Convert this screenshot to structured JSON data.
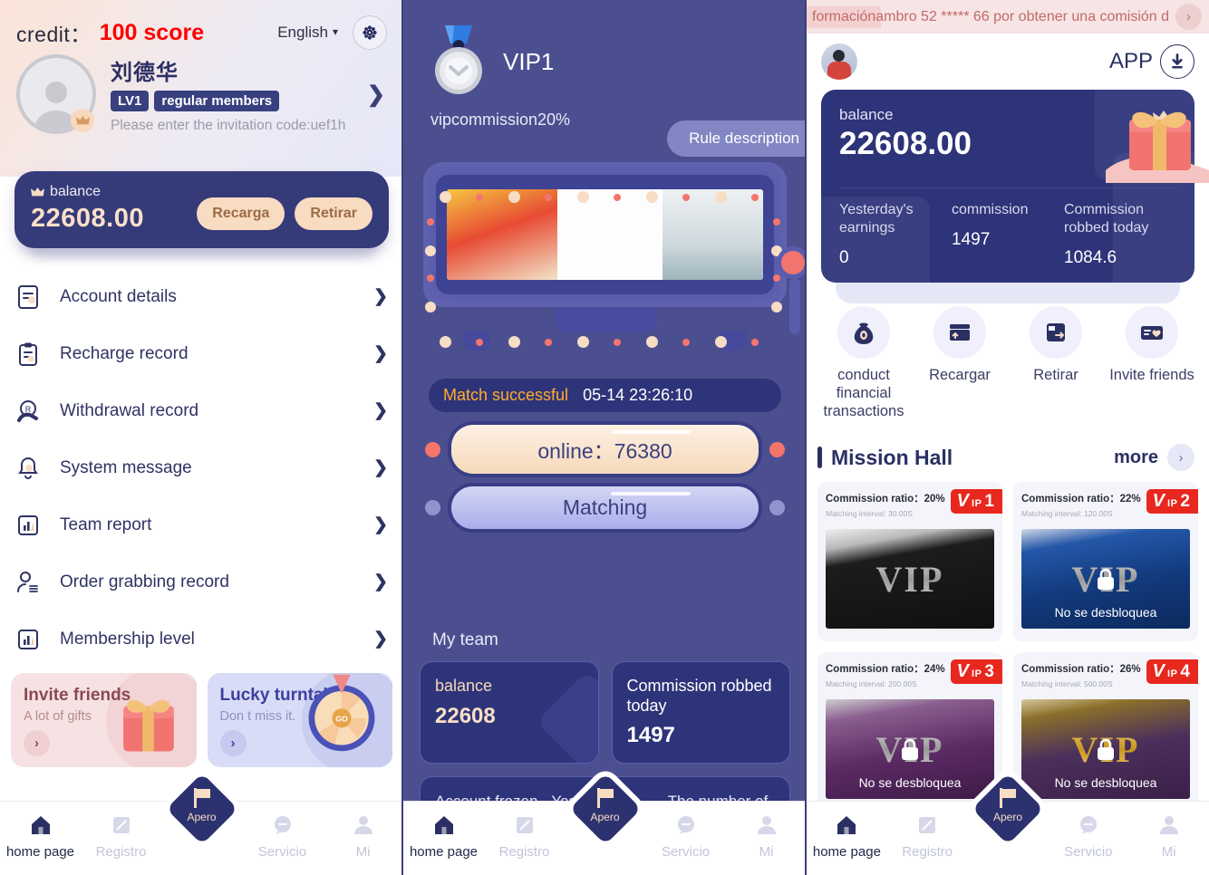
{
  "screen1": {
    "credit": {
      "label": "credit：",
      "value": "100 score"
    },
    "language": {
      "value": "English",
      "chevron": "⌄"
    },
    "settings_icon": "gear-icon",
    "profile": {
      "username": "刘德华",
      "level_tag": "LV1",
      "member_tag": "regular members",
      "invite_note": "Please enter the invitation code:uef1h",
      "chevron": "❯"
    },
    "balance_card": {
      "label": "balance",
      "amount": "22608.00",
      "recharge_label": "Recarga",
      "withdraw_label": "Retirar"
    },
    "menu": [
      {
        "label": "Account details",
        "icon": "document-list-icon",
        "chevron": "❯"
      },
      {
        "label": "Recharge record",
        "icon": "clipboard-icon",
        "chevron": "❯"
      },
      {
        "label": "Withdrawal record",
        "icon": "withdraw-hand-icon",
        "chevron": "❯"
      },
      {
        "label": "System message",
        "icon": "bell-icon",
        "chevron": "❯"
      },
      {
        "label": "Team report",
        "icon": "bar-chart-icon",
        "chevron": "❯"
      },
      {
        "label": "Order grabbing record",
        "icon": "person-list-icon",
        "chevron": "❯"
      },
      {
        "label": "Membership level",
        "icon": "bar-chart-icon",
        "chevron": "❯"
      }
    ],
    "promos": [
      {
        "title": "Invite friends",
        "subtitle": "A lot of gifts",
        "arrow": "›",
        "icon": "gift-box-icon"
      },
      {
        "title": "Lucky turntable",
        "subtitle": "Don t miss it.",
        "arrow": "›",
        "icon": "fortune-wheel-icon",
        "wheel_text": "GO"
      }
    ]
  },
  "screen2": {
    "vip": {
      "level": "VIP1",
      "commission": "vipcommission20%",
      "medal_icon": "medal-icon"
    },
    "rule_button": "Rule description",
    "match": {
      "status": "Match successful",
      "time": "05-14 23:26:10"
    },
    "online": {
      "label": "online：",
      "value": "76380"
    },
    "matching_label": "Matching",
    "my_team": {
      "title": "My team",
      "cards": [
        {
          "label": "balance",
          "value": "22608"
        },
        {
          "label": "Commission robbed today",
          "value": "1497"
        }
      ],
      "row2": [
        "Account frozen",
        "Yesterday's earnings",
        "The number of"
      ]
    }
  },
  "screen3": {
    "notice": {
      "tag": "formación",
      "text": "ambro 52 ***** 66 por obtener una comisión d",
      "next_arrow": "›"
    },
    "header": {
      "app_label": "APP",
      "download_icon": "download-arrow-icon",
      "avatar": "user-avatar"
    },
    "balance_card": {
      "label": "balance",
      "amount": "22608.00",
      "crown_icon": "crown-icon",
      "stats": [
        {
          "label": "Yesterday's earnings",
          "value": "0"
        },
        {
          "label": "commission",
          "value": "1497"
        },
        {
          "label": "Commission robbed today",
          "value": "1084.6"
        }
      ]
    },
    "quick_actions": [
      {
        "label": "conduct financial transactions",
        "icon": "money-bag-icon"
      },
      {
        "label": "Recargar",
        "icon": "card-up-icon"
      },
      {
        "label": "Retirar",
        "icon": "wallet-out-icon"
      },
      {
        "label": "Invite friends",
        "icon": "card-heart-icon"
      }
    ],
    "mission_hall": {
      "title": "Mission Hall",
      "more_label": "more",
      "more_arrow": "›",
      "cards": [
        {
          "ratio": "Commission ratio：20%",
          "interval": "Matching interval: 30.00S",
          "badge_v": "V",
          "badge_ip": "IP",
          "badge_num": "1",
          "word": "VIP",
          "locked": false,
          "locked_text": ""
        },
        {
          "ratio": "Commission ratio：22%",
          "interval": "Matching interval: 120.00S",
          "badge_v": "V",
          "badge_ip": "IP",
          "badge_num": "2",
          "word": "VIP",
          "locked": true,
          "locked_text": "No se desbloquea"
        },
        {
          "ratio": "Commission ratio：24%",
          "interval": "Matching interval: 200.00S",
          "badge_v": "V",
          "badge_ip": "IP",
          "badge_num": "3",
          "word": "VIP",
          "locked": true,
          "locked_text": "No se desbloquea"
        },
        {
          "ratio": "Commission ratio：26%",
          "interval": "Matching interval: 500.00S",
          "badge_v": "V",
          "badge_ip": "IP",
          "badge_num": "4",
          "word": "VIP",
          "locked": true,
          "locked_text": "No se desbloquea"
        }
      ]
    }
  },
  "tabbar": {
    "items": [
      {
        "label": "home page",
        "icon": "home-icon",
        "active": true
      },
      {
        "label": "Registro",
        "icon": "note-icon",
        "active": false
      },
      {
        "label": "",
        "icon": "",
        "active": false
      },
      {
        "label": "Servicio",
        "icon": "service-chat-icon",
        "active": false
      },
      {
        "label": "Mi",
        "icon": "person-icon",
        "active": false
      }
    ],
    "fab": {
      "label": "Apero",
      "icon": "flag-icon"
    }
  },
  "colors": {
    "brand_navy": "#2e3479",
    "panel_purple": "#4c4f8f",
    "accent_cream": "#f8dcc1",
    "credit_red": "#ff0000",
    "badge_red": "#e8271f",
    "match_orange": "#ffad2b"
  }
}
